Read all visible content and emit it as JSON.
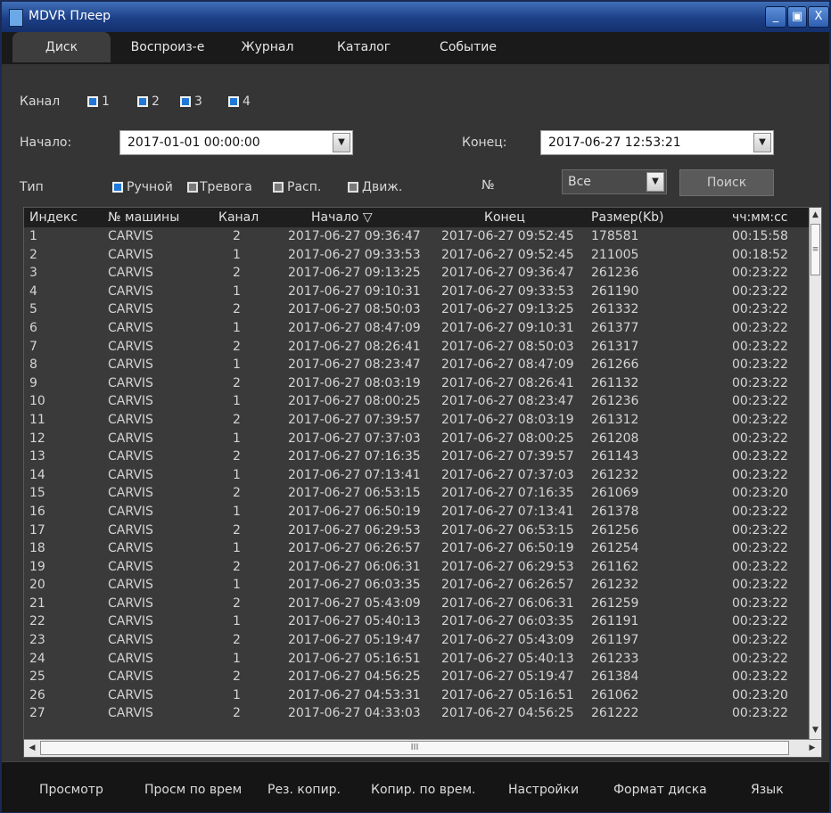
{
  "window": {
    "title": "MDVR Плеер",
    "controls": {
      "minimize": "_",
      "maximize": "▣",
      "close": "X"
    }
  },
  "tabs": [
    {
      "label": "Диск",
      "active": true
    },
    {
      "label": "Воспроиз-е",
      "active": false
    },
    {
      "label": "Журнал",
      "active": false
    },
    {
      "label": "Каталог",
      "active": false
    },
    {
      "label": "Событие",
      "active": false
    }
  ],
  "filters": {
    "channel_label": "Канал",
    "channels": [
      {
        "label": "1",
        "checked": true
      },
      {
        "label": "2",
        "checked": true
      },
      {
        "label": "3",
        "checked": true
      },
      {
        "label": "4",
        "checked": true
      }
    ],
    "start_label": "Начало:",
    "start_value": "2017-01-01 00:00:00",
    "end_label": "Конец:",
    "end_value": "2017-06-27 12:53:21",
    "type_label": "Тип",
    "types": [
      {
        "label": "Ручной",
        "checked": true
      },
      {
        "label": "Тревога",
        "checked": false
      },
      {
        "label": "Расп.",
        "checked": false
      },
      {
        "label": "Движ.",
        "checked": false
      }
    ],
    "number_label": "№",
    "number_value": "Все",
    "search_label": "Поиск"
  },
  "table": {
    "columns": [
      "Индекс",
      "№ машины",
      "Канал",
      "Начало ▽",
      "Конец",
      "Размер(Kb)",
      "чч:мм:сс"
    ],
    "rows": [
      [
        "1",
        "CARVIS",
        "2",
        "2017-06-27 09:36:47",
        "2017-06-27 09:52:45",
        "178581",
        "00:15:58"
      ],
      [
        "2",
        "CARVIS",
        "1",
        "2017-06-27 09:33:53",
        "2017-06-27 09:52:45",
        "211005",
        "00:18:52"
      ],
      [
        "3",
        "CARVIS",
        "2",
        "2017-06-27 09:13:25",
        "2017-06-27 09:36:47",
        "261236",
        "00:23:22"
      ],
      [
        "4",
        "CARVIS",
        "1",
        "2017-06-27 09:10:31",
        "2017-06-27 09:33:53",
        "261190",
        "00:23:22"
      ],
      [
        "5",
        "CARVIS",
        "2",
        "2017-06-27 08:50:03",
        "2017-06-27 09:13:25",
        "261332",
        "00:23:22"
      ],
      [
        "6",
        "CARVIS",
        "1",
        "2017-06-27 08:47:09",
        "2017-06-27 09:10:31",
        "261377",
        "00:23:22"
      ],
      [
        "7",
        "CARVIS",
        "2",
        "2017-06-27 08:26:41",
        "2017-06-27 08:50:03",
        "261317",
        "00:23:22"
      ],
      [
        "8",
        "CARVIS",
        "1",
        "2017-06-27 08:23:47",
        "2017-06-27 08:47:09",
        "261266",
        "00:23:22"
      ],
      [
        "9",
        "CARVIS",
        "2",
        "2017-06-27 08:03:19",
        "2017-06-27 08:26:41",
        "261132",
        "00:23:22"
      ],
      [
        "10",
        "CARVIS",
        "1",
        "2017-06-27 08:00:25",
        "2017-06-27 08:23:47",
        "261236",
        "00:23:22"
      ],
      [
        "11",
        "CARVIS",
        "2",
        "2017-06-27 07:39:57",
        "2017-06-27 08:03:19",
        "261312",
        "00:23:22"
      ],
      [
        "12",
        "CARVIS",
        "1",
        "2017-06-27 07:37:03",
        "2017-06-27 08:00:25",
        "261208",
        "00:23:22"
      ],
      [
        "13",
        "CARVIS",
        "2",
        "2017-06-27 07:16:35",
        "2017-06-27 07:39:57",
        "261143",
        "00:23:22"
      ],
      [
        "14",
        "CARVIS",
        "1",
        "2017-06-27 07:13:41",
        "2017-06-27 07:37:03",
        "261232",
        "00:23:22"
      ],
      [
        "15",
        "CARVIS",
        "2",
        "2017-06-27 06:53:15",
        "2017-06-27 07:16:35",
        "261069",
        "00:23:20"
      ],
      [
        "16",
        "CARVIS",
        "1",
        "2017-06-27 06:50:19",
        "2017-06-27 07:13:41",
        "261378",
        "00:23:22"
      ],
      [
        "17",
        "CARVIS",
        "2",
        "2017-06-27 06:29:53",
        "2017-06-27 06:53:15",
        "261256",
        "00:23:22"
      ],
      [
        "18",
        "CARVIS",
        "1",
        "2017-06-27 06:26:57",
        "2017-06-27 06:50:19",
        "261254",
        "00:23:22"
      ],
      [
        "19",
        "CARVIS",
        "2",
        "2017-06-27 06:06:31",
        "2017-06-27 06:29:53",
        "261162",
        "00:23:22"
      ],
      [
        "20",
        "CARVIS",
        "1",
        "2017-06-27 06:03:35",
        "2017-06-27 06:26:57",
        "261232",
        "00:23:22"
      ],
      [
        "21",
        "CARVIS",
        "2",
        "2017-06-27 05:43:09",
        "2017-06-27 06:06:31",
        "261259",
        "00:23:22"
      ],
      [
        "22",
        "CARVIS",
        "1",
        "2017-06-27 05:40:13",
        "2017-06-27 06:03:35",
        "261191",
        "00:23:22"
      ],
      [
        "23",
        "CARVIS",
        "2",
        "2017-06-27 05:19:47",
        "2017-06-27 05:43:09",
        "261197",
        "00:23:22"
      ],
      [
        "24",
        "CARVIS",
        "1",
        "2017-06-27 05:16:51",
        "2017-06-27 05:40:13",
        "261233",
        "00:23:22"
      ],
      [
        "25",
        "CARVIS",
        "2",
        "2017-06-27 04:56:25",
        "2017-06-27 05:19:47",
        "261384",
        "00:23:22"
      ],
      [
        "26",
        "CARVIS",
        "1",
        "2017-06-27 04:53:31",
        "2017-06-27 05:16:51",
        "261062",
        "00:23:20"
      ],
      [
        "27",
        "CARVIS",
        "2",
        "2017-06-27 04:33:03",
        "2017-06-27 04:56:25",
        "261222",
        "00:23:22"
      ]
    ]
  },
  "bottom_buttons": [
    "Просмотр",
    "Просм по врем",
    "Рез. копир.",
    "Копир. по врем.",
    "Настройки",
    "Формат диска",
    "Язык"
  ],
  "colors": {
    "background": "#353535",
    "titlebar": "#1c3f86",
    "checkbox_checked": "#1f78d7"
  }
}
